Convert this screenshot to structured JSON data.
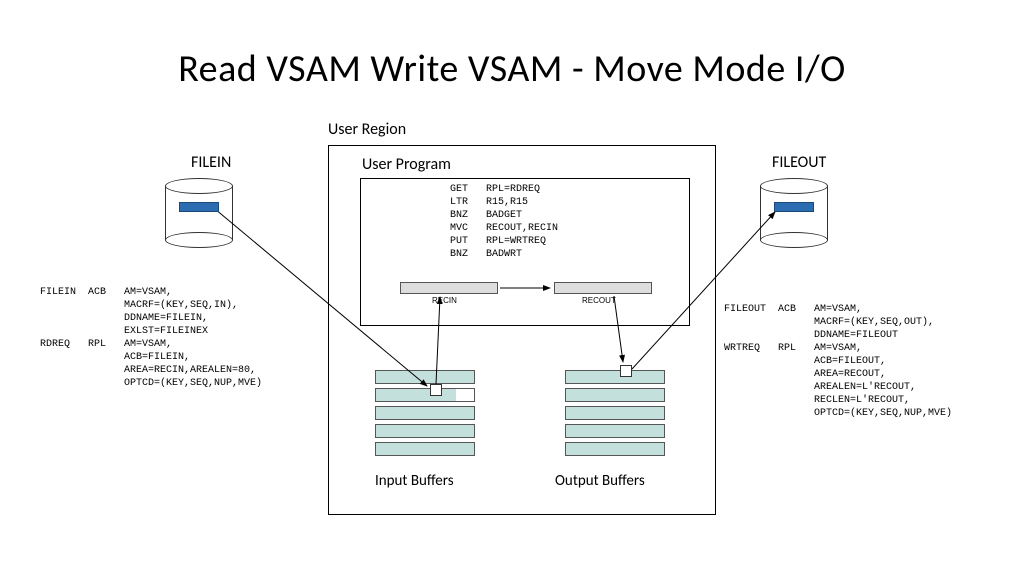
{
  "title": "Read VSAM Write VSAM - Move Mode I/O",
  "labels": {
    "user_region": "User Region",
    "user_program": "User Program",
    "filein": "FILEIN",
    "fileout": "FILEOUT",
    "recin": "RECIN",
    "recout": "RECOUT",
    "input_buffers": "Input Buffers",
    "output_buffers": "Output Buffers"
  },
  "assembly_code": "GET   RPL=RDREQ\nLTR   R15,R15\nBNZ   BADGET\nMVC   RECOUT,RECIN\nPUT   RPL=WRTREQ\nBNZ   BADWRT",
  "acb_left": "FILEIN  ACB   AM=VSAM,\n              MACRF=(KEY,SEQ,IN),\n              DDNAME=FILEIN,\n              EXLST=FILEINEX\nRDREQ   RPL   AM=VSAM,\n              ACB=FILEIN,\n              AREA=RECIN,AREALEN=80,\n              OPTCD=(KEY,SEQ,NUP,MVE)",
  "acb_right": "FILEOUT  ACB   AM=VSAM,\n               MACRF=(KEY,SEQ,OUT),\n               DDNAME=FILEOUT\nWRTREQ   RPL   AM=VSAM,\n               ACB=FILEOUT,\n               AREA=RECOUT,\n               AREALEN=L'RECOUT,\n               RECLEN=L'RECOUT,\n               OPTCD=(KEY,SEQ,NUP,MVE)",
  "buffer_rows": 5,
  "colors": {
    "buffer_fill": "#c4e0dc",
    "cylinder_stripe": "#2c6cb0"
  }
}
